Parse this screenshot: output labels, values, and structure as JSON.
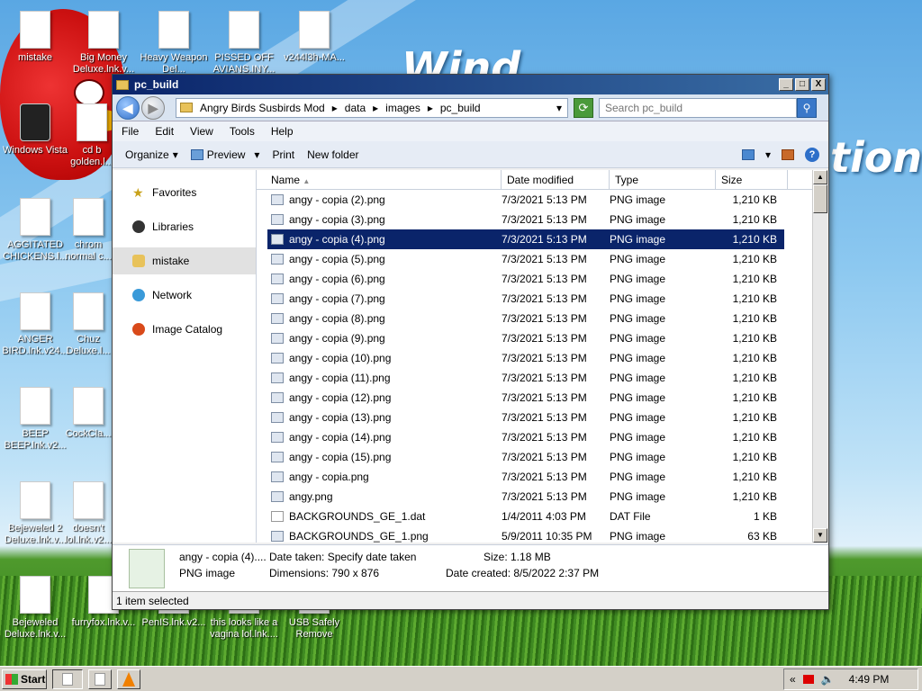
{
  "desktop": {
    "brand_left": "Wind",
    "brand_right": "tion",
    "icons": [
      {
        "label": "mistake"
      },
      {
        "label": "Big Money Deluxe.lnk.v..."
      },
      {
        "label": "Heavy Weapon Del..."
      },
      {
        "label": "PISSED OFF AVIANS.INY..."
      },
      {
        "label": "v244l3h-MA..."
      },
      {
        "label": "Windows Vista"
      },
      {
        "label": "cd b golden.l..."
      },
      {
        "label": "AGGITATED CHICKENS.l..."
      },
      {
        "label": "chrom normal c..."
      },
      {
        "label": "ANGER BIRD.lnk.v24..."
      },
      {
        "label": "Chuz Deluxe.l..."
      },
      {
        "label": "BEEP BEEP.lnk.v2..."
      },
      {
        "label": "CockCla..."
      },
      {
        "label": "Bejeweled 2 Deluxe.lnk.v..."
      },
      {
        "label": "doesn't lol.lnk.v2..."
      },
      {
        "label": "Bejeweled Deluxe.lnk.v..."
      },
      {
        "label": "furryfox.lnk.v..."
      },
      {
        "label": "PenIS.lnk.v2..."
      },
      {
        "label": "this looks like a vagina lol.lnk...."
      },
      {
        "label": "USB Safely Remove"
      }
    ]
  },
  "window": {
    "title": "pc_build",
    "controls": {
      "minimize": "_",
      "maximize": "□",
      "close": "X"
    },
    "address": {
      "crumbs": [
        "Angry Birds Susbirds Mod",
        "data",
        "images",
        "pc_build"
      ],
      "sep": "▸"
    },
    "search_placeholder": "Search pc_build",
    "menu": [
      "File",
      "Edit",
      "View",
      "Tools",
      "Help"
    ],
    "commands": {
      "organize": "Organize",
      "preview": "Preview",
      "print": "Print",
      "new_folder": "New folder"
    },
    "nav": [
      {
        "label": "Favorites",
        "icon": "star-icon"
      },
      {
        "label": "Libraries",
        "icon": "libraries-icon"
      },
      {
        "label": "mistake",
        "icon": "user-folder-icon"
      },
      {
        "label": "Network",
        "icon": "network-icon"
      },
      {
        "label": "Image Catalog",
        "icon": "image-catalog-icon"
      }
    ],
    "columns": [
      "Name",
      "Date modified",
      "Type",
      "Size"
    ],
    "files": [
      {
        "name": "angy - copia (2).png",
        "date": "7/3/2021 5:13 PM",
        "type": "PNG image",
        "size": "1,210 KB"
      },
      {
        "name": "angy - copia (3).png",
        "date": "7/3/2021 5:13 PM",
        "type": "PNG image",
        "size": "1,210 KB"
      },
      {
        "name": "angy - copia (4).png",
        "date": "7/3/2021 5:13 PM",
        "type": "PNG image",
        "size": "1,210 KB"
      },
      {
        "name": "angy - copia (5).png",
        "date": "7/3/2021 5:13 PM",
        "type": "PNG image",
        "size": "1,210 KB"
      },
      {
        "name": "angy - copia (6).png",
        "date": "7/3/2021 5:13 PM",
        "type": "PNG image",
        "size": "1,210 KB"
      },
      {
        "name": "angy - copia (7).png",
        "date": "7/3/2021 5:13 PM",
        "type": "PNG image",
        "size": "1,210 KB"
      },
      {
        "name": "angy - copia (8).png",
        "date": "7/3/2021 5:13 PM",
        "type": "PNG image",
        "size": "1,210 KB"
      },
      {
        "name": "angy - copia (9).png",
        "date": "7/3/2021 5:13 PM",
        "type": "PNG image",
        "size": "1,210 KB"
      },
      {
        "name": "angy - copia (10).png",
        "date": "7/3/2021 5:13 PM",
        "type": "PNG image",
        "size": "1,210 KB"
      },
      {
        "name": "angy - copia (11).png",
        "date": "7/3/2021 5:13 PM",
        "type": "PNG image",
        "size": "1,210 KB"
      },
      {
        "name": "angy - copia (12).png",
        "date": "7/3/2021 5:13 PM",
        "type": "PNG image",
        "size": "1,210 KB"
      },
      {
        "name": "angy - copia (13).png",
        "date": "7/3/2021 5:13 PM",
        "type": "PNG image",
        "size": "1,210 KB"
      },
      {
        "name": "angy - copia (14).png",
        "date": "7/3/2021 5:13 PM",
        "type": "PNG image",
        "size": "1,210 KB"
      },
      {
        "name": "angy - copia (15).png",
        "date": "7/3/2021 5:13 PM",
        "type": "PNG image",
        "size": "1,210 KB"
      },
      {
        "name": "angy - copia.png",
        "date": "7/3/2021 5:13 PM",
        "type": "PNG image",
        "size": "1,210 KB"
      },
      {
        "name": "angy.png",
        "date": "7/3/2021 5:13 PM",
        "type": "PNG image",
        "size": "1,210 KB"
      },
      {
        "name": "BACKGROUNDS_GE_1.dat",
        "date": "1/4/2011 4:03 PM",
        "type": "DAT File",
        "size": "1 KB"
      },
      {
        "name": "BACKGROUNDS_GE_1.png",
        "date": "5/9/2011 10:35 PM",
        "type": "PNG image",
        "size": "63 KB"
      }
    ],
    "selected_index": 2,
    "details": {
      "filename": "angy - copia (4)....",
      "filetype": "PNG image",
      "date_taken": "Date taken: Specify date taken",
      "dimensions": "Dimensions: 790 x 876",
      "size": "Size: 1.18 MB",
      "date_created": "Date created: 8/5/2022 2:37 PM"
    },
    "status": "1 item selected"
  },
  "taskbar": {
    "start": "Start",
    "clock": "4:49 PM",
    "tray_arrow": "«"
  },
  "colors": {
    "selection": "#0a246a",
    "titlebar": "#0a246a"
  }
}
